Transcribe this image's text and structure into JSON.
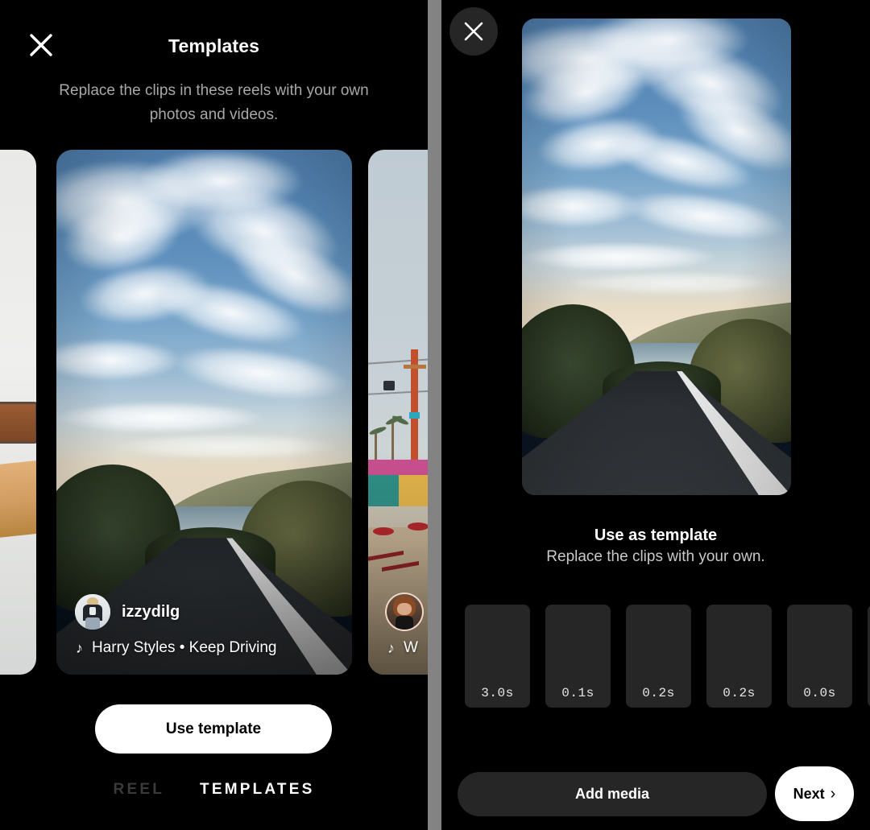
{
  "left_panel": {
    "close_icon": "close-icon",
    "title": "Templates",
    "subtitle": "Replace the clips in these reels with your own photos and videos.",
    "cards": [
      {
        "position": "peek-left",
        "scene": "bright interior with wooden bench and table"
      },
      {
        "position": "main",
        "scene": "coastal road at golden hour under blue sky with wispy clouds",
        "username": "izzydilg",
        "audio_icon": "music-note-icon",
        "audio": "Harry Styles • Keep Driving"
      },
      {
        "position": "peek-right",
        "scene": "beach boardwalk with chairlift, palm trees and red picnic tables",
        "username": "",
        "audio_icon": "music-note-icon",
        "audio": "W"
      }
    ],
    "use_template_label": "Use template",
    "tabs": [
      {
        "label": "REEL",
        "active": false
      },
      {
        "label": "TEMPLATES",
        "active": true
      }
    ]
  },
  "right_panel": {
    "close_icon": "close-icon",
    "preview_scene": "coastal road at golden hour under blue sky with wispy clouds",
    "headline": "Use as template",
    "subheadline": "Replace the clips with your own.",
    "clips": [
      {
        "duration": "3.0s"
      },
      {
        "duration": "0.1s"
      },
      {
        "duration": "0.2s"
      },
      {
        "duration": "0.2s"
      },
      {
        "duration": "0.0s"
      },
      {
        "duration": ""
      }
    ],
    "add_media_label": "Add media",
    "next_label": "Next",
    "next_icon": "chevron-right-icon"
  },
  "colors": {
    "background": "#000000",
    "divider": "#838383",
    "primary_button_bg": "#ffffff",
    "primary_button_text": "#000000",
    "secondary_button_bg": "#262626",
    "secondary_button_text": "#ffffff",
    "clip_bg": "#262626",
    "muted_text": "#a8a8a8",
    "inactive_tab": "#3a3a3a"
  }
}
